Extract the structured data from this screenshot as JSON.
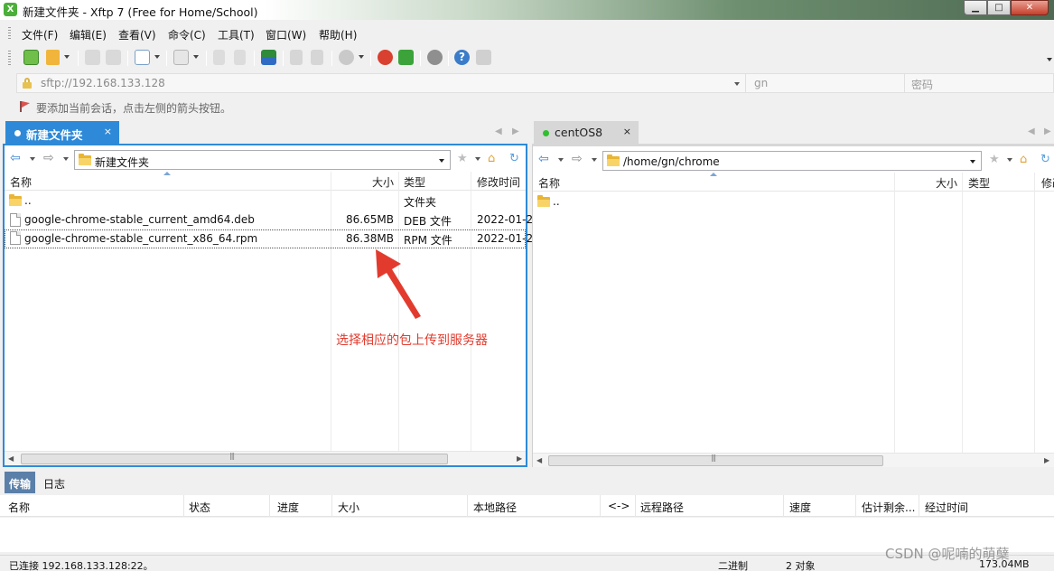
{
  "window": {
    "title": "新建文件夹 - Xftp 7 (Free for Home/School)",
    "minimize_glyph": "▁",
    "maximize_glyph": "□",
    "close_glyph": "✕"
  },
  "menu": [
    "文件(F)",
    "编辑(E)",
    "查看(V)",
    "命令(C)",
    "工具(T)",
    "窗口(W)",
    "帮助(H)"
  ],
  "toolbar": {
    "icons": [
      "new-session-icon",
      "open-folder-icon",
      "link-icon",
      "unlink-icon",
      "new-window-icon",
      "play-icon",
      "copy-icon",
      "paste-icon",
      "transfer-icon",
      "delete-icon",
      "refresh-icon",
      "record-icon",
      "xshell-icon",
      "xftp-icon",
      "gear-icon",
      "help-icon",
      "chat-icon"
    ]
  },
  "address": {
    "url": "sftp://192.168.133.128",
    "user_placeholder": "gn",
    "password_placeholder": "密码"
  },
  "hint": "要添加当前会话，点击左侧的箭头按钮。",
  "tabs": {
    "local": {
      "label": "新建文件夹",
      "close": "×"
    },
    "remote": {
      "label": "centOS8",
      "close": "×"
    },
    "nav_left": "◀",
    "nav_right": "▶"
  },
  "local_panel": {
    "path": "新建文件夹",
    "columns": {
      "name": "名称",
      "size": "大小",
      "type": "类型",
      "modified": "修改时间"
    },
    "rows": [
      {
        "name": "..",
        "size": "",
        "type": "文件夹",
        "modified": ""
      },
      {
        "name": "google-chrome-stable_current_amd64.deb",
        "size": "86.65MB",
        "type": "DEB 文件",
        "modified": "2022-01-2"
      },
      {
        "name": "google-chrome-stable_current_x86_64.rpm",
        "size": "86.38MB",
        "type": "RPM 文件",
        "modified": "2022-01-2"
      }
    ]
  },
  "remote_panel": {
    "path": "/home/gn/chrome",
    "columns": {
      "name": "名称",
      "size": "大小",
      "type": "类型",
      "modified": "修改"
    },
    "rows": [
      {
        "name": "..",
        "size": "",
        "type": "",
        "modified": ""
      }
    ]
  },
  "scroll": {
    "left_arrow": "◀",
    "right_arrow": "▶",
    "grip": "|||"
  },
  "annotation": "选择相应的包上传到服务器",
  "transfer": {
    "tabs": {
      "transfer": "传输",
      "log": "日志"
    },
    "columns": [
      "名称",
      "状态",
      "进度",
      "大小",
      "本地路径",
      "<->",
      "远程路径",
      "速度",
      "估计剩余...",
      "经过时间"
    ]
  },
  "status": {
    "connection": "已连接 192.168.133.128:22。",
    "mode": "二进制",
    "objects": "2 对象",
    "size": "173.04MB"
  },
  "watermark": "CSDN @呢喃的萌蘖",
  "colors": {
    "accent_blue": "#2e8ad8",
    "annotation_red": "#e23b2e",
    "folder_yellow": "#f8d468",
    "online_green": "#2fbf2f"
  }
}
